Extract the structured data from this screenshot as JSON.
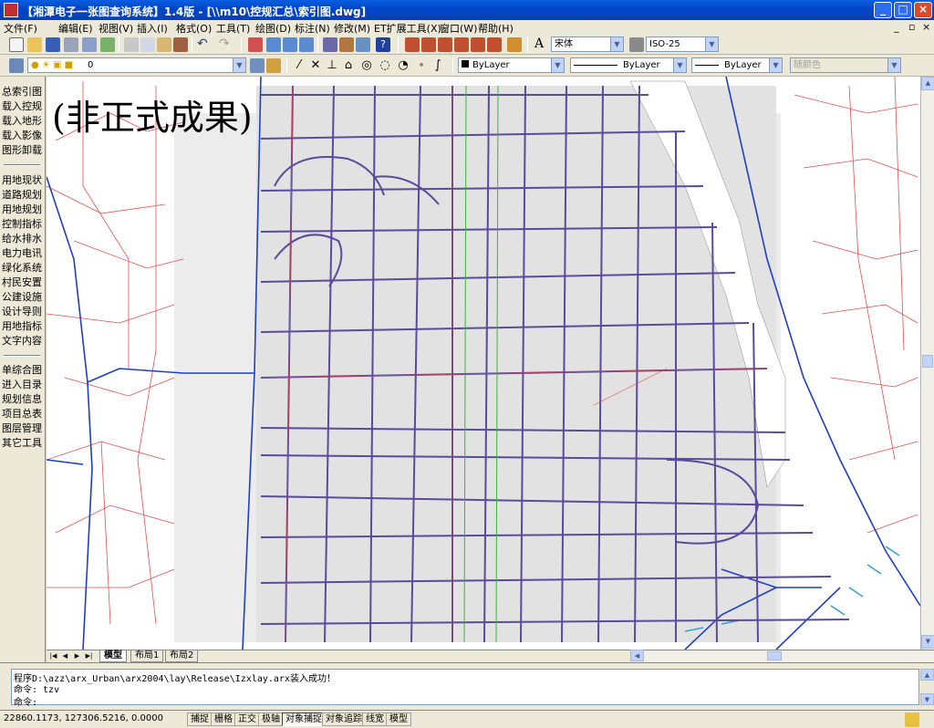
{
  "window": {
    "title": "【湘潭电子一张图查询系统】1.4版 - [\\\\m10\\控规汇总\\索引图.dwg]"
  },
  "menu": [
    "文件(F)",
    "编辑(E)",
    "视图(V)",
    "插入(I)",
    "格式(O)",
    "工具(T)",
    "绘图(D)",
    "标注(N)",
    "修改(M)",
    "ET扩展工具(X)",
    "窗口(W)",
    "帮助(H)"
  ],
  "toolbar": {
    "font": "宋体",
    "dimstyle": "ISO-25",
    "layer": "0",
    "color": "ByLayer",
    "linetype": "ByLayer",
    "lineweight": "ByLayer",
    "plotstyle": "随颜色"
  },
  "sidebar": {
    "group1": [
      "总索引图",
      "载入控规",
      "载入地形",
      "载入影像",
      "图形卸载"
    ],
    "group2": [
      "用地现状",
      "道路规划",
      "用地规划",
      "控制指标",
      "给水排水",
      "电力电讯",
      "绿化系统",
      "村民安置",
      "公建设施",
      "设计导则",
      "用地指标",
      "文字内容"
    ],
    "group3": [
      "单综合图",
      "进入目录",
      "规划信息",
      "项目总表",
      "图层管理",
      "其它工具"
    ]
  },
  "drawing": {
    "watermark": "(非正式成果)"
  },
  "tabs": {
    "model": "模型",
    "layout1": "布局1",
    "layout2": "布局2"
  },
  "command": {
    "line1": "程序D:\\azz\\arx_Urban\\arx2004\\lay\\Release\\Izxlay.arx装入成功！",
    "line2": "命令: tzv",
    "line3": "命令:"
  },
  "status": {
    "coords": "22860.1173, 127306.5216, 0.0000",
    "toggles": [
      "捕捉",
      "栅格",
      "正交",
      "极轴",
      "对象捕捉",
      "对象追踪",
      "线宽",
      "模型"
    ]
  },
  "colors": {
    "titlebar": "#0047c8",
    "road": "#5a4a9a",
    "boundary": "#1f3fbf",
    "redline": "#e04040"
  }
}
